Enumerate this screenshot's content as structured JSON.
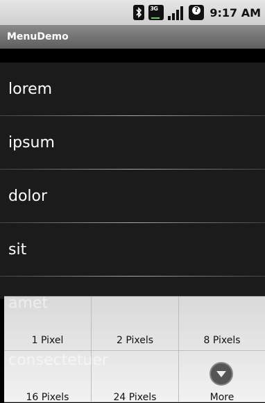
{
  "status_bar": {
    "network_label": "3G",
    "time": "9:17 AM",
    "icons": [
      "bluetooth-icon",
      "network-3g-icon",
      "signal-icon",
      "alert-icon"
    ]
  },
  "title_bar": {
    "title": "MenuDemo"
  },
  "list": {
    "items": [
      {
        "label": "lorem"
      },
      {
        "label": "ipsum"
      },
      {
        "label": "dolor"
      },
      {
        "label": "sit"
      },
      {
        "label": "amet"
      },
      {
        "label": "consectetuer"
      }
    ]
  },
  "options_menu": {
    "items": [
      {
        "label": "1 Pixel"
      },
      {
        "label": "2 Pixels"
      },
      {
        "label": "8 Pixels"
      },
      {
        "label": "16 Pixels"
      },
      {
        "label": "24 Pixels"
      },
      {
        "label": "More",
        "icon": "more-icon"
      }
    ]
  }
}
